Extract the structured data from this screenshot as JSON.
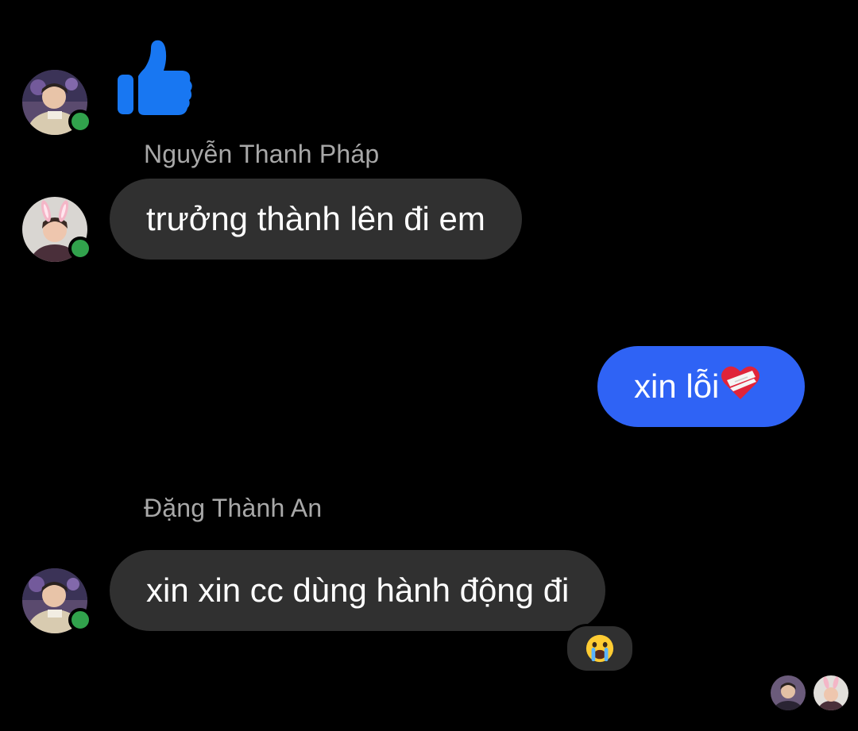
{
  "conversation": {
    "messages": [
      {
        "sender": "",
        "type": "like-sticker",
        "icon": "thumbs-up-icon",
        "color": "#1877f2"
      },
      {
        "sender": "Nguyễn Thanh Pháp",
        "type": "incoming",
        "text": "trưởng thành lên đi em"
      },
      {
        "sender": "",
        "type": "outgoing",
        "text": "xin lỗi",
        "emoji": "mending-heart-icon"
      },
      {
        "sender": "Đặng Thành An",
        "type": "incoming",
        "text": "xin xin cc dùng hành động đi",
        "reaction": "crying-face-icon"
      }
    ],
    "read_receipts": [
      "avatar-an",
      "avatar-phap"
    ]
  },
  "colors": {
    "background": "#000000",
    "incoming_bubble": "#303030",
    "outgoing_bubble": "#2f63f5",
    "online": "#31a24c",
    "sender_name": "#a8a8a8"
  }
}
